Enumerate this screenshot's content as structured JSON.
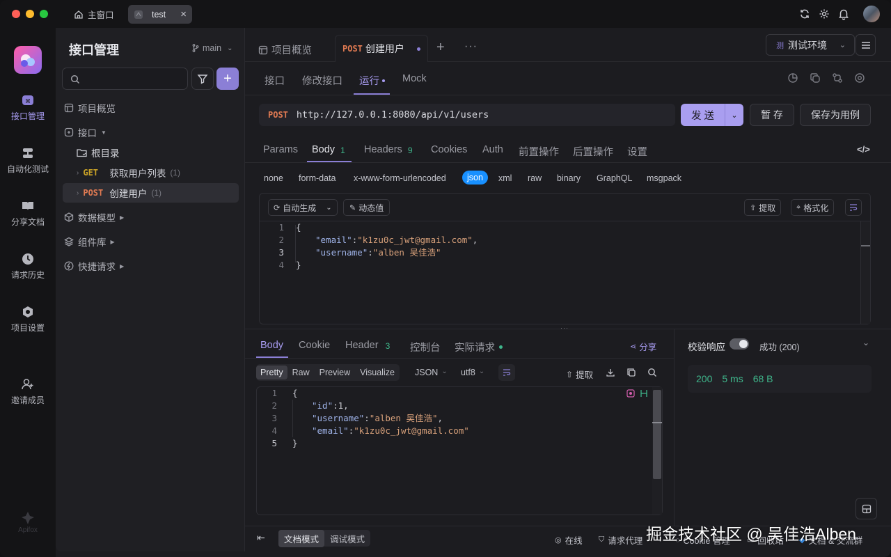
{
  "titlebar": {
    "home_tab": "主窗口",
    "active_tab": "test"
  },
  "rail": {
    "items": [
      "接口管理",
      "自动化测试",
      "分享文档",
      "请求历史",
      "项目设置",
      "邀请成员"
    ],
    "brand": "Apifox"
  },
  "sidebar": {
    "title": "接口管理",
    "branch": "main",
    "search_placeholder": "",
    "tree": {
      "overview": "项目概览",
      "interfaces": "接口",
      "root": "根目录",
      "get_method": "GET",
      "get_name": "获取用户列表",
      "get_count": "(1)",
      "post_method": "POST",
      "post_name": "创建用户",
      "post_count": "(1)",
      "models": "数据模型",
      "components": "组件库",
      "quick": "快捷请求"
    }
  },
  "main": {
    "doc_tabs": {
      "overview": "项目概览",
      "active_method": "POST",
      "active_name": "创建用户"
    },
    "env": {
      "icon_letter": "测",
      "label": "测试环境"
    },
    "sub_tabs": [
      "接口",
      "修改接口",
      "运行",
      "Mock"
    ],
    "request": {
      "method": "POST",
      "url": "http://127.0.0.1:8080/api/v1/users",
      "send": "发 送",
      "save_temp": "暂 存",
      "save_case": "保存为用例"
    },
    "param_tabs": {
      "params": "Params",
      "body": "Body",
      "body_count": "1",
      "headers": "Headers",
      "headers_count": "9",
      "cookies": "Cookies",
      "auth": "Auth",
      "pre": "前置操作",
      "post": "后置操作",
      "settings": "设置"
    },
    "body_types": [
      "none",
      "form-data",
      "x-www-form-urlencoded",
      "json",
      "xml",
      "raw",
      "binary",
      "GraphQL",
      "msgpack"
    ],
    "editor_toolbar": {
      "auto_gen": "自动生成",
      "dynamic": "动态值",
      "extract": "提取",
      "format": "格式化"
    },
    "request_body_lines": [
      {
        "n": "1",
        "t": "{"
      },
      {
        "n": "2",
        "k": "\"email\"",
        "v": "\"k1zu0c_jwt@gmail.com\"",
        "tail": ","
      },
      {
        "n": "3",
        "k": "\"username\"",
        "v": "\"alben 吴佳浩\"",
        "tail": ""
      },
      {
        "n": "4",
        "t": "}"
      }
    ]
  },
  "response": {
    "tabs": {
      "body": "Body",
      "cookie": "Cookie",
      "header": "Header",
      "header_count": "3",
      "console": "控制台",
      "actual": "实际请求"
    },
    "share": "分享",
    "view_modes": [
      "Pretty",
      "Raw",
      "Preview",
      "Visualize"
    ],
    "format": "JSON",
    "encoding": "utf8",
    "extract": "提取",
    "lines": [
      {
        "n": "1",
        "t": "{"
      },
      {
        "n": "2",
        "k": "\"id\"",
        "num": "1",
        "tail": ","
      },
      {
        "n": "3",
        "k": "\"username\"",
        "v": "\"alben 吴佳浩\"",
        "tail": ","
      },
      {
        "n": "4",
        "k": "\"email\"",
        "v": "\"k1zu0c_jwt@gmail.com\"",
        "tail": ""
      },
      {
        "n": "5",
        "t": "}"
      }
    ],
    "validate_label": "校验响应",
    "status_text": "成功 (200)",
    "stats": {
      "code": "200",
      "time": "5 ms",
      "size": "68 B"
    }
  },
  "statusbar": {
    "doc_mode": "文档模式",
    "debug_mode": "调试模式",
    "online": "在线",
    "proxy": "请求代理",
    "cookie": "Cookie 管理",
    "recycle": "回收站",
    "docs": "文档 & 交流群"
  },
  "watermark": "掘金技术社区 @ 吴佳浩Alben",
  "colors": {
    "accent": "#8b7fd6",
    "post": "#e07a52",
    "get": "#c9a227",
    "success": "#3fb68b"
  }
}
